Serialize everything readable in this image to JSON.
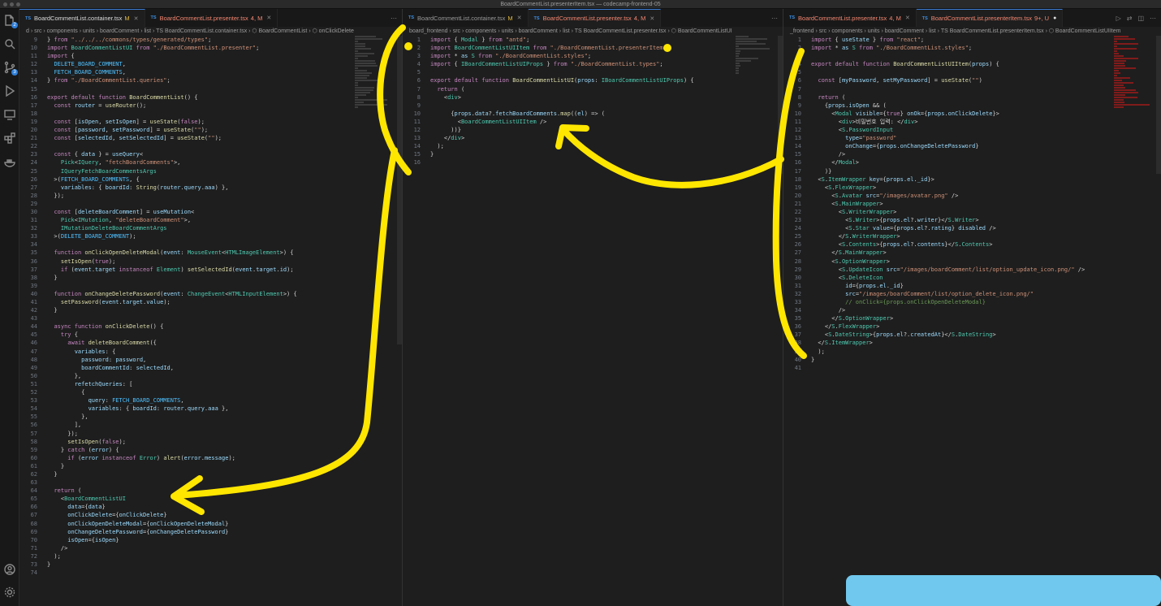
{
  "window_title": "BoardCommentList.presenterItem.tsx — codecamp-frontend-05",
  "activity_bar": {
    "items": [
      {
        "name": "explorer-icon",
        "badge": "2"
      },
      {
        "name": "search-icon",
        "badge": ""
      },
      {
        "name": "source-control-icon",
        "badge": "3"
      },
      {
        "name": "run-debug-icon",
        "badge": ""
      },
      {
        "name": "remote-explorer-icon",
        "badge": ""
      },
      {
        "name": "extensions-icon",
        "badge": ""
      },
      {
        "name": "docker-icon",
        "badge": ""
      }
    ],
    "bottom": [
      "account-icon",
      "settings-gear-icon"
    ]
  },
  "panes": [
    {
      "tabs": [
        {
          "label": "BoardCommentList.container.tsx",
          "mod": "M",
          "active": true,
          "err": false
        },
        {
          "label": "BoardCommentList.presenter.tsx",
          "mod": "4, M",
          "active": false,
          "err": true
        }
      ],
      "breadcrumb": "d › src › components › units › boardComment › list › TS BoardCommentList.container.tsx › ⬡ BoardCommentList › ⬡ onClickDelete",
      "lines": [
        {
          "n": 9,
          "t": "} from \"../../../commons/types/generated/types\";"
        },
        {
          "n": 10,
          "t": "import BoardCommentListUI from \"./BoardCommentList.presenter\";"
        },
        {
          "n": 11,
          "t": "import {"
        },
        {
          "n": 12,
          "t": "  DELETE_BOARD_COMMENT,"
        },
        {
          "n": 13,
          "t": "  FETCH_BOARD_COMMENTS,"
        },
        {
          "n": 14,
          "t": "} from \"./BoardCommentList.queries\";"
        },
        {
          "n": 15,
          "t": ""
        },
        {
          "n": 16,
          "t": "export default function BoardCommentList() {"
        },
        {
          "n": 17,
          "t": "  const router = useRouter();"
        },
        {
          "n": 18,
          "t": ""
        },
        {
          "n": 19,
          "t": "  const [isOpen, setIsOpen] = useState(false);"
        },
        {
          "n": 20,
          "t": "  const [password, setPassword] = useState(\"\");"
        },
        {
          "n": 21,
          "t": "  const [selectedId, setSelectedId] = useState(\"\");"
        },
        {
          "n": 22,
          "t": ""
        },
        {
          "n": 23,
          "t": "  const { data } = useQuery<"
        },
        {
          "n": 24,
          "t": "    Pick<IQuery, \"fetchBoardComments\">,"
        },
        {
          "n": 25,
          "t": "    IQueryFetchBoardCommentsArgs"
        },
        {
          "n": 26,
          "t": "  >(FETCH_BOARD_COMMENTS, {"
        },
        {
          "n": 27,
          "t": "    variables: { boardId: String(router.query.aaa) },"
        },
        {
          "n": 28,
          "t": "  });"
        },
        {
          "n": 29,
          "t": ""
        },
        {
          "n": 30,
          "t": "  const [deleteBoardComment] = useMutation<"
        },
        {
          "n": 31,
          "t": "    Pick<IMutation, \"deleteBoardComment\">,"
        },
        {
          "n": 32,
          "t": "    IMutationDeleteBoardCommentArgs"
        },
        {
          "n": 33,
          "t": "  >(DELETE_BOARD_COMMENT);"
        },
        {
          "n": 34,
          "t": ""
        },
        {
          "n": 35,
          "t": "  function onClickOpenDeleteModal(event: MouseEvent<HTMLImageElement>) {"
        },
        {
          "n": 36,
          "t": "    setIsOpen(true);"
        },
        {
          "n": 37,
          "t": "    if (event.target instanceof Element) setSelectedId(event.target.id);"
        },
        {
          "n": 38,
          "t": "  }"
        },
        {
          "n": 39,
          "t": ""
        },
        {
          "n": 40,
          "t": "  function onChangeDeletePassword(event: ChangeEvent<HTMLInputElement>) {"
        },
        {
          "n": 41,
          "t": "    setPassword(event.target.value);"
        },
        {
          "n": 42,
          "t": "  }"
        },
        {
          "n": 43,
          "t": ""
        },
        {
          "n": 44,
          "t": "  async function onClickDelete() {"
        },
        {
          "n": 45,
          "t": "    try {"
        },
        {
          "n": 46,
          "t": "      await deleteBoardComment({"
        },
        {
          "n": 47,
          "t": "        variables: {"
        },
        {
          "n": 48,
          "t": "          password: password,"
        },
        {
          "n": 49,
          "t": "          boardCommentId: selectedId,"
        },
        {
          "n": 50,
          "t": "        },"
        },
        {
          "n": 51,
          "t": "        refetchQueries: ["
        },
        {
          "n": 52,
          "t": "          {"
        },
        {
          "n": 53,
          "t": "            query: FETCH_BOARD_COMMENTS,"
        },
        {
          "n": 54,
          "t": "            variables: { boardId: router.query.aaa },"
        },
        {
          "n": 55,
          "t": "          },"
        },
        {
          "n": 56,
          "t": "        ],"
        },
        {
          "n": 57,
          "t": "      });"
        },
        {
          "n": 58,
          "t": "      setIsOpen(false);"
        },
        {
          "n": 59,
          "t": "    } catch (error) {"
        },
        {
          "n": 60,
          "t": "      if (error instanceof Error) alert(error.message);"
        },
        {
          "n": 61,
          "t": "    }"
        },
        {
          "n": 62,
          "t": "  }"
        },
        {
          "n": 63,
          "t": ""
        },
        {
          "n": 64,
          "t": "  return ("
        },
        {
          "n": 65,
          "t": "    <BoardCommentListUI"
        },
        {
          "n": 66,
          "t": "      data={data}"
        },
        {
          "n": 67,
          "t": "      onClickDelete={onClickDelete}"
        },
        {
          "n": 68,
          "t": "      onClickOpenDeleteModal={onClickOpenDeleteModal}"
        },
        {
          "n": 69,
          "t": "      onChangeDeletePassword={onChangeDeletePassword}"
        },
        {
          "n": 70,
          "t": "      isOpen={isOpen}"
        },
        {
          "n": 71,
          "t": "    />"
        },
        {
          "n": 72,
          "t": "  );"
        },
        {
          "n": 73,
          "t": "}"
        },
        {
          "n": 74,
          "t": ""
        }
      ]
    },
    {
      "tabs": [
        {
          "label": "BoardCommentList.container.tsx",
          "mod": "M",
          "active": false,
          "err": false
        },
        {
          "label": "BoardCommentList.presenter.tsx",
          "mod": "4, M",
          "active": true,
          "err": true
        }
      ],
      "breadcrumb": "board_frontend › src › components › units › boardComment › list › TS BoardCommentList.presenter.tsx › ⬡ BoardCommentListUI",
      "lines": [
        {
          "n": 1,
          "t": "import { Modal } from \"antd\";"
        },
        {
          "n": 2,
          "t": "import BoardCommentListUIItem from \"./BoardCommentList.presenterItem\";"
        },
        {
          "n": 3,
          "t": "import * as S from \"./BoardCommentList.styles\";"
        },
        {
          "n": 4,
          "t": "import { IBoardCommentListUIProps } from \"./BoardCommentList.types\";"
        },
        {
          "n": 5,
          "t": ""
        },
        {
          "n": 6,
          "t": "export default function BoardCommentListUI(props: IBoardCommentListUIProps) {"
        },
        {
          "n": 7,
          "t": "  return ("
        },
        {
          "n": 8,
          "t": "    <div>"
        },
        {
          "n": 9,
          "t": ""
        },
        {
          "n": 10,
          "t": "      {props.data?.fetchBoardComments.map((el) => ("
        },
        {
          "n": 11,
          "t": "        <BoardCommentListUIItem />"
        },
        {
          "n": 12,
          "t": "      ))}"
        },
        {
          "n": 13,
          "t": "    </div>"
        },
        {
          "n": 14,
          "t": "  );"
        },
        {
          "n": 15,
          "t": "}"
        },
        {
          "n": 16,
          "t": ""
        }
      ]
    },
    {
      "tabs": [
        {
          "label": "BoardCommentList.presenter.tsx",
          "mod": "4, M",
          "active": false,
          "err": true
        },
        {
          "label": "BoardCommentList.presenterItem.tsx",
          "mod": "9+, U",
          "active": true,
          "err": true
        }
      ],
      "breadcrumb": "_frontend › src › components › units › boardComment › list › TS BoardCommentList.presenterItem.tsx › ⬡ BoardCommentListUIItem",
      "lines": [
        {
          "n": 1,
          "t": "import { useState } from \"react\";"
        },
        {
          "n": 2,
          "t": "import * as S from \"./BoardCommentList.styles\";"
        },
        {
          "n": 3,
          "t": ""
        },
        {
          "n": 4,
          "t": "export default function BoardCommentListUIItem(props) {"
        },
        {
          "n": 5,
          "t": ""
        },
        {
          "n": 6,
          "t": "  const [myPassword, setMyPassword] = useState(\"\")"
        },
        {
          "n": 7,
          "t": ""
        },
        {
          "n": 8,
          "t": "  return ("
        },
        {
          "n": 9,
          "t": "    {props.isOpen && ("
        },
        {
          "n": 10,
          "t": "      <Modal visible={true} onOk={props.onClickDelete}>"
        },
        {
          "n": 11,
          "t": "        <div>비밀번호 입력: </div>"
        },
        {
          "n": 12,
          "t": "        <S.PasswordInput"
        },
        {
          "n": 13,
          "t": "          type=\"password\""
        },
        {
          "n": 14,
          "t": "          onChange={props.onChangeDeletePassword}"
        },
        {
          "n": 15,
          "t": "        />"
        },
        {
          "n": 16,
          "t": "      </Modal>"
        },
        {
          "n": 17,
          "t": "    )}"
        },
        {
          "n": 18,
          "t": "  <S.ItemWrapper key={props.el._id}>"
        },
        {
          "n": 19,
          "t": "    <S.FlexWrapper>"
        },
        {
          "n": 20,
          "t": "      <S.Avatar src=\"/images/avatar.png\" />"
        },
        {
          "n": 21,
          "t": "      <S.MainWrapper>"
        },
        {
          "n": 22,
          "t": "        <S.WriterWrapper>"
        },
        {
          "n": 23,
          "t": "          <S.Writer>{props.el?.writer}</S.Writer>"
        },
        {
          "n": 24,
          "t": "          <S.Star value={props.el?.rating} disabled />"
        },
        {
          "n": 25,
          "t": "        </S.WriterWrapper>"
        },
        {
          "n": 26,
          "t": "        <S.Contents>{props.el?.contents}</S.Contents>"
        },
        {
          "n": 27,
          "t": "      </S.MainWrapper>"
        },
        {
          "n": 28,
          "t": "      <S.OptionWrapper>"
        },
        {
          "n": 29,
          "t": "        <S.UpdateIcon src=\"/images/boardComment/list/option_update_icon.png/\" />"
        },
        {
          "n": 30,
          "t": "        <S.DeleteIcon"
        },
        {
          "n": 31,
          "t": "          id={props.el._id}"
        },
        {
          "n": 32,
          "t": "          src=\"/images/boardComment/list/option_delete_icon.png/\""
        },
        {
          "n": 33,
          "t": "          // onClick={props.onClickOpenDeleteModal}"
        },
        {
          "n": 34,
          "t": "        />"
        },
        {
          "n": 35,
          "t": "      </S.OptionWrapper>"
        },
        {
          "n": 36,
          "t": "    </S.FlexWrapper>"
        },
        {
          "n": 37,
          "t": "    <S.DateString>{props.el?.createdAt}</S.DateString>"
        },
        {
          "n": 38,
          "t": "  </S.ItemWrapper>"
        },
        {
          "n": 39,
          "t": "  );"
        },
        {
          "n": 40,
          "t": "}"
        },
        {
          "n": 41,
          "t": ""
        }
      ]
    }
  ],
  "colors": {
    "annotation": "#ffe600",
    "redaction": "#70c8ee",
    "error_minimap": "#d11a1a",
    "accent": "#3a7bd5"
  }
}
